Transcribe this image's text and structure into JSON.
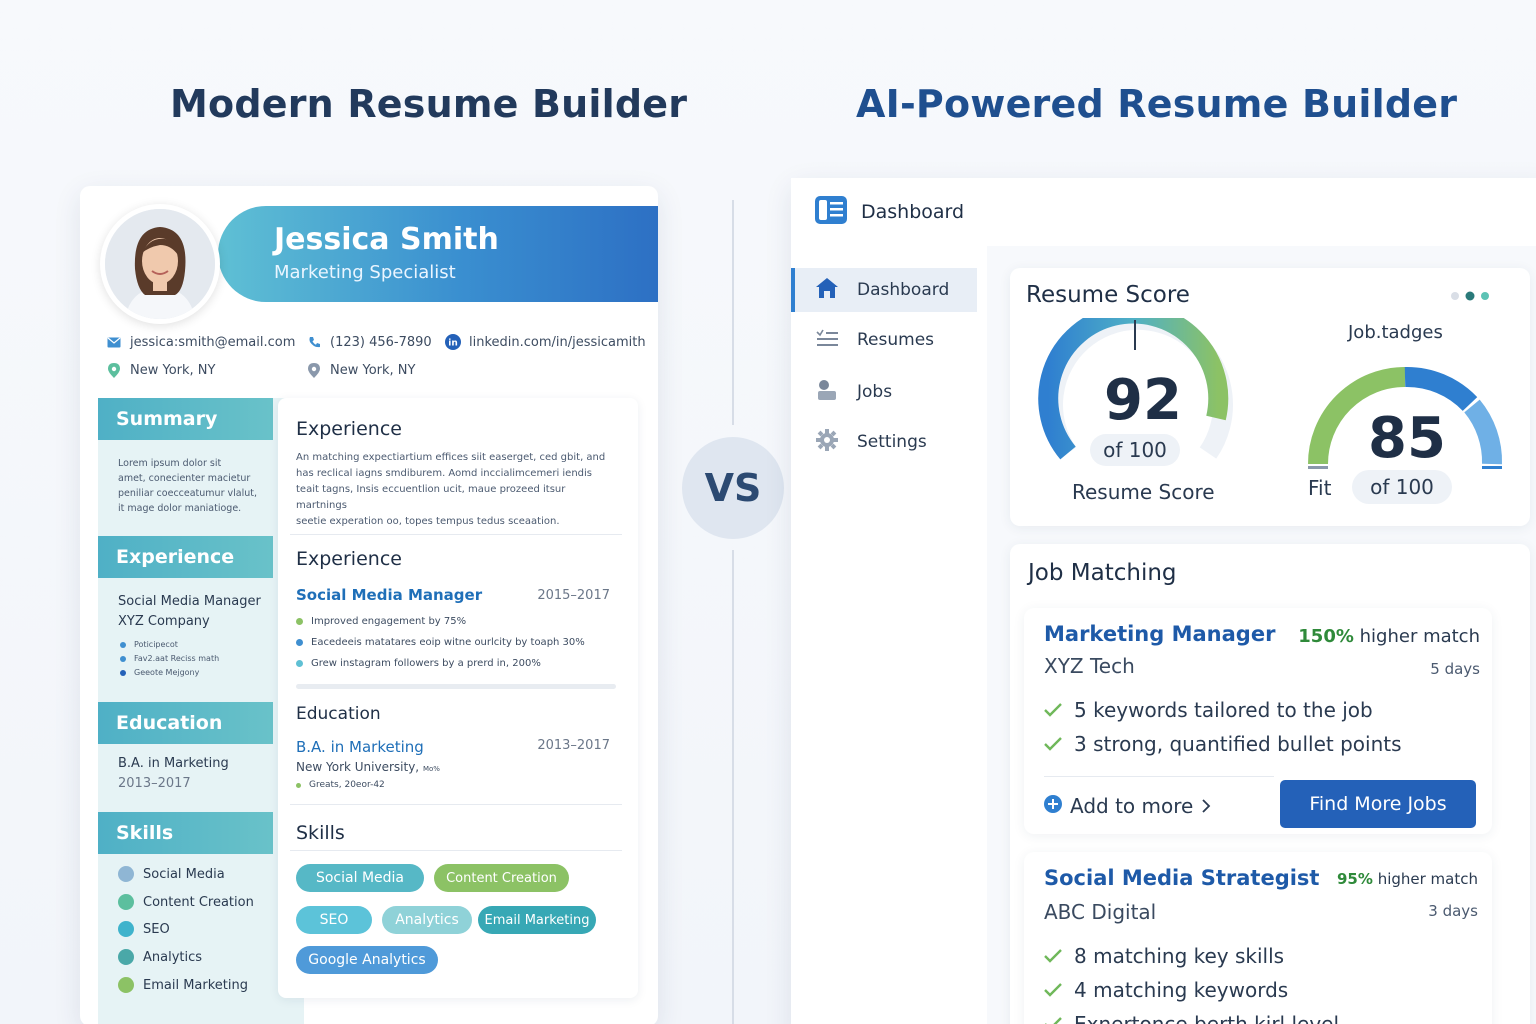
{
  "headings": {
    "left": "Modern Resume Builder",
    "right": "AI-Powered Resume Builder",
    "vs": "VS"
  },
  "resume": {
    "name": "Jessica Smith",
    "title": "Marketing Specialist",
    "contact": {
      "email": "jessica:smith@email.com",
      "phone": "(123) 456-7890",
      "linkedin": "linkedin.com/in/jessicamith",
      "location_1": "New York, NY",
      "location_2": "New York, NY"
    },
    "sidebar": {
      "summary_heading": "Summary",
      "summary_text": [
        "Lorem ipsum dolor sit",
        "amet, conecienter macietur",
        "peniliar coecceatumur vlalut,",
        "it mage dolor maniatioge."
      ],
      "experience_heading": "Experience",
      "experience_role": "Social Media Manager",
      "experience_company": "XYZ Company",
      "experience_bullets": [
        "Poticipecot",
        "Fav2.aat Reciss math",
        "Geeote Mejgony"
      ],
      "education_heading": "Education",
      "education_degree": "B.A. in Marketing",
      "education_years": "2013–2017",
      "skills_heading": "Skills",
      "skills": [
        {
          "label": "Social Media",
          "color": "#8fb6d4"
        },
        {
          "label": "Content Creation",
          "color": "#5cbf9e"
        },
        {
          "label": "SEO",
          "color": "#3fb3cc"
        },
        {
          "label": "Analytics",
          "color": "#4aa8a8"
        },
        {
          "label": "Email Marketing",
          "color": "#8cc265"
        }
      ]
    },
    "main": {
      "experience_heading": "Experience",
      "experience_text": [
        "An matching expectiartium effices siit easerget, ced gbit, and",
        "has reclical iagns smdiburem. Aomd inccialimcemeri iendis",
        "teait tagns, Insis eccuentlion ucit, maue prozeed itsur martnings",
        "seetie experation oo, topes tempus tedus sceaation."
      ],
      "experience_heading_2": "Experience",
      "job_title": "Social Media Manager",
      "job_years": "2015–2017",
      "job_bullets": [
        {
          "text": "Improved engagement by 75%",
          "color": "#8cc265"
        },
        {
          "text": "Eacedeeis matatares eoip witne ourlcity by toaph 30%",
          "color": "#3f8fd0"
        },
        {
          "text": "Grew instagram followers by a prerd in, 200%",
          "color": "#5fc0d4"
        }
      ],
      "education_heading": "Education",
      "degree": "B.A. in Marketing",
      "degree_years": "2013–2017",
      "university": "New York University,",
      "university_note": "Mo%",
      "grad_bullet": "Greats, 20eor-42",
      "skills_heading": "Skills",
      "chips": [
        {
          "label": "Social Media",
          "color": "#56b8c6"
        },
        {
          "label": "Content Creation",
          "color": "#8cc265"
        },
        {
          "label": "SEO",
          "color": "#5cc3d9"
        },
        {
          "label": "Analytics",
          "color": "#8fd2d8"
        },
        {
          "label": "Email Marketing",
          "color": "#37a8b5"
        },
        {
          "label": "Google Analytics",
          "color": "#4f9ad9"
        }
      ]
    }
  },
  "dashboard": {
    "top_title": "Dashboard",
    "nav": [
      {
        "label": "Dashboard",
        "icon": "home-icon",
        "active": true
      },
      {
        "label": "Resumes",
        "icon": "list-icon",
        "active": false
      },
      {
        "label": "Jobs",
        "icon": "user-icon",
        "active": false
      },
      {
        "label": "Settings",
        "icon": "gear-icon",
        "active": false
      }
    ],
    "score_card": {
      "title": "Resume Score",
      "gauge1": {
        "value": "92",
        "of": "of 100",
        "label": "Resume Score",
        "level": 0.92
      },
      "gauge2": {
        "title": "Job.tadges",
        "value": "85",
        "of": "of 100",
        "label": "Fit",
        "level": 0.85
      }
    },
    "job_matching": {
      "title": "Job Matching",
      "matches": [
        {
          "role": "Marketing Manager",
          "company": "XYZ Tech",
          "pct": "150%",
          "pct_suffix": "higher match",
          "days": "5 days",
          "checks": [
            "5 keywords tailored to the job",
            "3 strong, quantified bullet points"
          ],
          "add_more": "Add to more",
          "button": "Find More Jobs"
        },
        {
          "role": "Social Media Strategist",
          "company": "ABC Digital",
          "pct": "95%",
          "pct_suffix": "higher match",
          "days": "3 days",
          "checks": [
            "8 matching key skills",
            "4 matching keywords",
            "Exnertonce berth kirl level"
          ]
        }
      ]
    }
  }
}
